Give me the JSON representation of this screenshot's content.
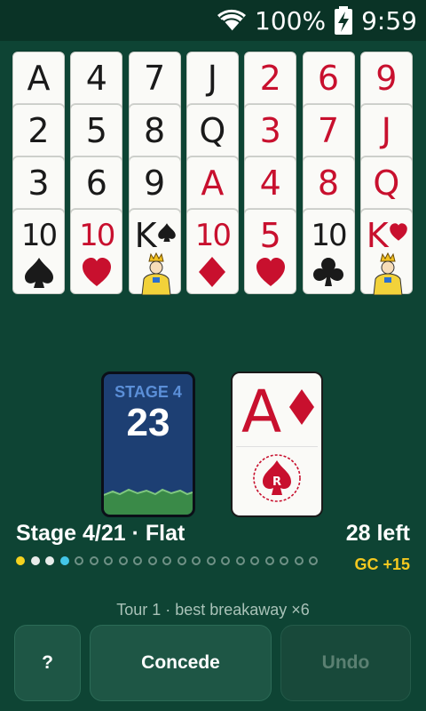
{
  "status_bar": {
    "battery_percent": "100%",
    "time": "9:59",
    "icons": [
      "wifi-icon",
      "battery-charging-icon"
    ]
  },
  "tableau": [
    {
      "cards": [
        {
          "rank": "A",
          "suit": "spades"
        },
        {
          "rank": "2",
          "suit": "spades"
        },
        {
          "rank": "3",
          "suit": "spades"
        },
        {
          "rank": "10",
          "suit": "spades"
        }
      ]
    },
    {
      "cards": [
        {
          "rank": "4",
          "suit": "spades"
        },
        {
          "rank": "5",
          "suit": "spades"
        },
        {
          "rank": "6",
          "suit": "spades"
        },
        {
          "rank": "10",
          "suit": "hearts"
        }
      ]
    },
    {
      "cards": [
        {
          "rank": "7",
          "suit": "spades"
        },
        {
          "rank": "8",
          "suit": "spades"
        },
        {
          "rank": "9",
          "suit": "spades"
        },
        {
          "rank": "K",
          "suit": "spades"
        }
      ]
    },
    {
      "cards": [
        {
          "rank": "J",
          "suit": "spades"
        },
        {
          "rank": "Q",
          "suit": "spades"
        },
        {
          "rank": "A",
          "suit": "diamonds"
        },
        {
          "rank": "10",
          "suit": "diamonds"
        }
      ]
    },
    {
      "cards": [
        {
          "rank": "2",
          "suit": "hearts"
        },
        {
          "rank": "3",
          "suit": "hearts"
        },
        {
          "rank": "4",
          "suit": "hearts"
        },
        {
          "rank": "5",
          "suit": "hearts"
        }
      ]
    },
    {
      "cards": [
        {
          "rank": "6",
          "suit": "hearts"
        },
        {
          "rank": "7",
          "suit": "hearts"
        },
        {
          "rank": "8",
          "suit": "hearts"
        },
        {
          "rank": "10",
          "suit": "clubs"
        }
      ]
    },
    {
      "cards": [
        {
          "rank": "9",
          "suit": "hearts"
        },
        {
          "rank": "J",
          "suit": "hearts"
        },
        {
          "rank": "Q",
          "suit": "hearts"
        },
        {
          "rank": "K",
          "suit": "hearts"
        }
      ]
    }
  ],
  "stock": {
    "stage_label": "STAGE 4",
    "count": "23"
  },
  "waste": {
    "rank": "A",
    "suit": "diamonds",
    "emblem_letter": "R"
  },
  "info": {
    "stage_text": "Stage 4/21 · Flat",
    "cards_left": "28 left",
    "gc_bonus": "GC +15",
    "tour_text": "Tour 1  ·  best breakaway ×6"
  },
  "progress": {
    "total_stages": 21,
    "current_stage": 4
  },
  "buttons": {
    "help": "?",
    "concede": "Concede",
    "undo": "Undo"
  },
  "colors": {
    "felt": "#0e4434",
    "red_suit": "#c8102e",
    "black_suit": "#1a1a1a",
    "stock_back": "#1d3f73",
    "gc_yellow": "#f4c81f",
    "current_dot": "#43c6e8"
  }
}
